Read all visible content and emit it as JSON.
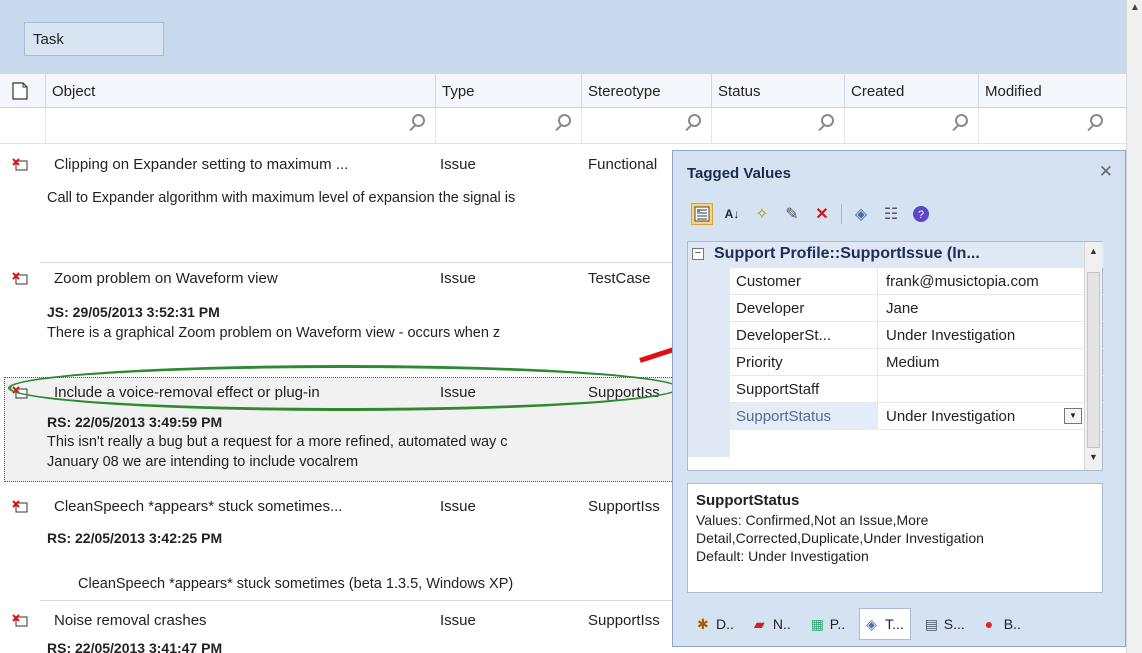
{
  "group_by": {
    "label": "Task"
  },
  "columns": [
    {
      "label": "Object",
      "width": 390
    },
    {
      "label": "Type",
      "width": 146
    },
    {
      "label": "Stereotype",
      "width": 130
    },
    {
      "label": "Status",
      "width": 133
    },
    {
      "label": "Created",
      "width": 134
    },
    {
      "label": "Modified",
      "width": 134
    }
  ],
  "rows": [
    {
      "object": "Clipping on Expander setting to maximum ...",
      "type": "Issue",
      "stereotype": "Functional",
      "note_head": "",
      "note": "Call to Expander algorithm with maximum level of expansion the signal is"
    },
    {
      "object": "Zoom problem on Waveform view",
      "type": "Issue",
      "stereotype": "TestCase",
      "note_head": "JS: 29/05/2013 3:52:31 PM",
      "note": "There is a graphical Zoom problem on Waveform view - occurs when z"
    },
    {
      "object": "Include a voice-removal effect or plug-in",
      "type": "Issue",
      "stereotype": "SupportIss",
      "note_head": "RS: 22/05/2013 3:49:59 PM",
      "note": "This isn't really a bug but a request for a more refined, automated way c",
      "note2": "January 08 we are intending to include vocalrem"
    },
    {
      "object": "CleanSpeech *appears* stuck sometimes...",
      "type": "Issue",
      "stereotype": "SupportIss",
      "note_head": "RS: 22/05/2013 3:42:25 PM",
      "note": "CleanSpeech *appears* stuck sometimes (beta 1.3.5, Windows XP)"
    },
    {
      "object": "Noise removal crashes",
      "type": "Issue",
      "stereotype": "SupportIss",
      "note_head": "RS: 22/05/2013 3:41:47 PM"
    }
  ],
  "panel": {
    "title": "Tagged Values",
    "category": "Support Profile::SupportIssue (In...",
    "tags": [
      {
        "key": "Customer",
        "value": "frank@musictopia.com"
      },
      {
        "key": "Developer",
        "value": "Jane"
      },
      {
        "key": "DeveloperSt...",
        "value": "Under Investigation"
      },
      {
        "key": "Priority",
        "value": "Medium"
      },
      {
        "key": "SupportStaff",
        "value": ""
      },
      {
        "key": "SupportStatus",
        "value": "Under Investigation"
      }
    ],
    "description": {
      "title": "SupportStatus",
      "line1": "Values: Confirmed,Not an Issue,More",
      "line2": "Detail,Corrected,Duplicate,Under Investigation",
      "line3": "Default: Under Investigation"
    },
    "tabs": [
      {
        "label": "D..",
        "icon": "bug-icon"
      },
      {
        "label": "N..",
        "icon": "notes-icon"
      },
      {
        "label": "P..",
        "icon": "properties-icon"
      },
      {
        "label": "T...",
        "icon": "tag-icon"
      },
      {
        "label": "S...",
        "icon": "scenario-icon"
      },
      {
        "label": "B..",
        "icon": "breakpoint-icon"
      }
    ]
  },
  "colors": {
    "header_band": "#c9d9ee",
    "panel_bg": "#d5e2f2",
    "arrow": "#dd1111",
    "ellipse": "#2f8a2f"
  }
}
